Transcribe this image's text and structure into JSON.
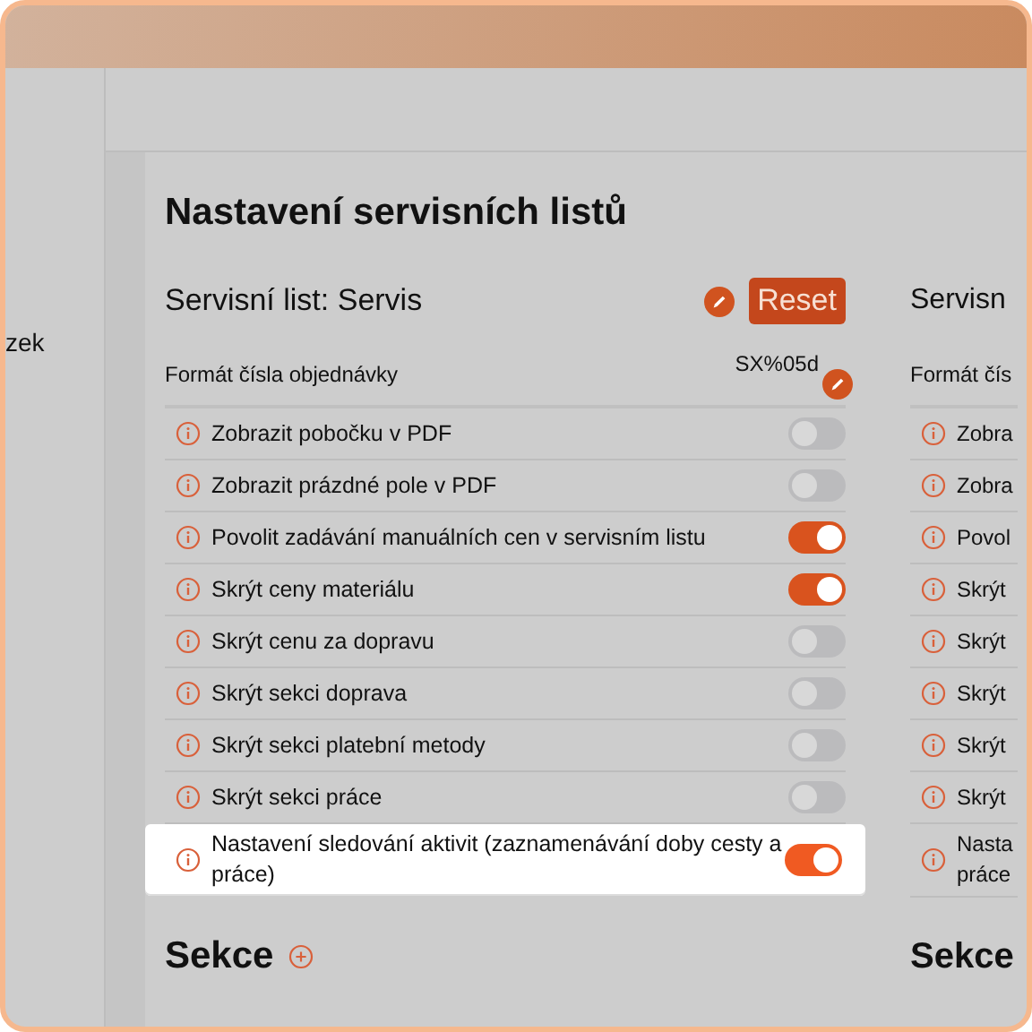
{
  "sidebar": {
    "item": "zek"
  },
  "page": {
    "title": "Nastavení servisních listů"
  },
  "columns": [
    {
      "title": "Servisní list: Servis",
      "reset": "Reset",
      "format": {
        "label": "Formát čísla objednávky",
        "value": "SX%05d"
      },
      "rows": [
        {
          "label": "Zobrazit pobočku v PDF",
          "on": false,
          "highlighted": false
        },
        {
          "label": "Zobrazit prázdné pole v PDF",
          "on": false,
          "highlighted": false
        },
        {
          "label": "Povolit zadávání manuálních cen v servisním listu",
          "on": true,
          "highlighted": false
        },
        {
          "label": "Skrýt ceny materiálu",
          "on": true,
          "highlighted": false
        },
        {
          "label": "Skrýt cenu za dopravu",
          "on": false,
          "highlighted": false
        },
        {
          "label": "Skrýt sekci doprava",
          "on": false,
          "highlighted": false
        },
        {
          "label": "Skrýt sekci platební metody",
          "on": false,
          "highlighted": false
        },
        {
          "label": "Skrýt sekci práce",
          "on": false,
          "highlighted": false
        },
        {
          "label": "Nastavení sledování aktivit (zaznamenávání doby cesty a práce)",
          "on": true,
          "highlighted": true
        }
      ],
      "sections": "Sekce"
    },
    {
      "title": "Servisn",
      "format": {
        "label": "Formát čís"
      },
      "rows": [
        {
          "label": "Zobra"
        },
        {
          "label": "Zobra"
        },
        {
          "label": "Povol"
        },
        {
          "label": "Skrýt"
        },
        {
          "label": "Skrýt"
        },
        {
          "label": "Skrýt"
        },
        {
          "label": "Skrýt"
        },
        {
          "label": "Skrýt"
        },
        {
          "label": "Nasta práce"
        }
      ],
      "sections": "Sekce"
    }
  ]
}
